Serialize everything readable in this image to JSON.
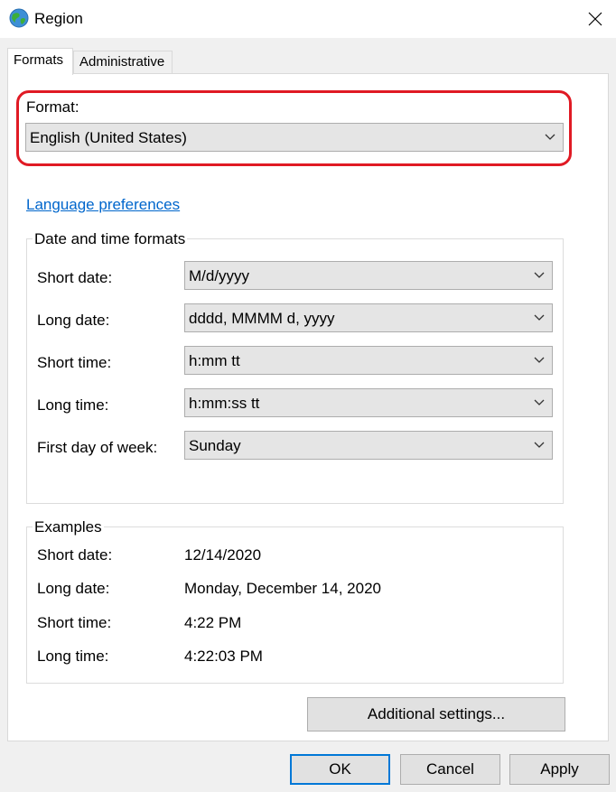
{
  "window": {
    "title": "Region",
    "app_icon": "globe-icon"
  },
  "tabs": [
    {
      "label": "Formats",
      "active": true
    },
    {
      "label": "Administrative",
      "active": false
    }
  ],
  "format": {
    "label": "Format:",
    "value": "English (United States)"
  },
  "language_link": "Language preferences",
  "date_time_formats": {
    "title": "Date and time formats",
    "rows": [
      {
        "label": "Short date:",
        "value": "M/d/yyyy"
      },
      {
        "label": "Long date:",
        "value": "dddd, MMMM d, yyyy"
      },
      {
        "label": "Short time:",
        "value": "h:mm tt"
      },
      {
        "label": "Long time:",
        "value": "h:mm:ss tt"
      },
      {
        "label": "First day of week:",
        "value": "Sunday"
      }
    ]
  },
  "examples": {
    "title": "Examples",
    "rows": [
      {
        "label": "Short date:",
        "value": "12/14/2020"
      },
      {
        "label": "Long date:",
        "value": "Monday, December 14, 2020"
      },
      {
        "label": "Short time:",
        "value": "4:22 PM"
      },
      {
        "label": "Long time:",
        "value": "4:22:03 PM"
      }
    ]
  },
  "buttons": {
    "additional_settings": "Additional settings...",
    "ok": "OK",
    "cancel": "Cancel",
    "apply": "Apply"
  },
  "colors": {
    "highlight": "#e01a24",
    "link": "#0066cc",
    "focus": "#0078d7"
  }
}
